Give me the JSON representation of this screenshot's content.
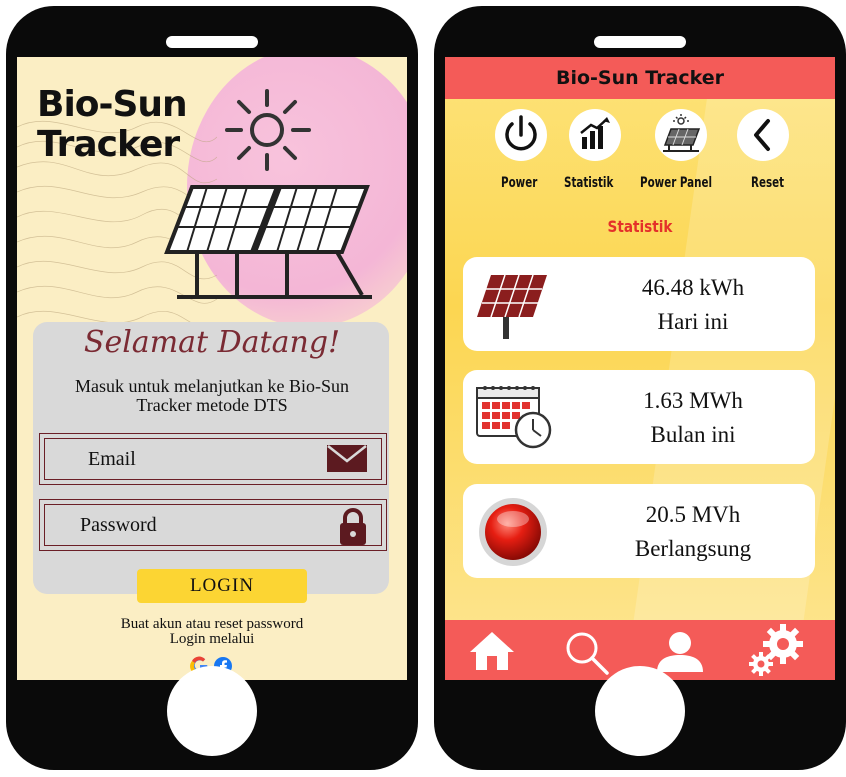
{
  "login_screen": {
    "brand_line1": "Bio-Sun",
    "brand_line2": "Tracker",
    "welcome": "Selamat Datang!",
    "subtitle_line1": "Masuk untuk melanjutkan ke Bio-Sun",
    "subtitle_line2": "Tracker metode DTS",
    "email_label": "Email",
    "password_label": "Password",
    "login_button": "LOGIN",
    "footer_line1": "Buat akun atau reset password",
    "footer_line2": "Login melalui",
    "social_icons": [
      "google-icon",
      "facebook-icon"
    ]
  },
  "dashboard_screen": {
    "header_title": "Bio-Sun Tracker",
    "nav": [
      {
        "label": "Power",
        "icon": "power-icon"
      },
      {
        "label": "Statistik",
        "icon": "bar-chart-icon"
      },
      {
        "label": "Power Panel",
        "icon": "solar-panel-icon"
      },
      {
        "label": "Reset",
        "icon": "chevron-left-icon"
      }
    ],
    "section_title": "Statistik",
    "stats": [
      {
        "value": "46.48 kWh",
        "label": "Hari ini",
        "icon": "solar-panel-icon"
      },
      {
        "value": "1.63 MWh",
        "label": "Bulan ini",
        "icon": "calendar-clock-icon"
      },
      {
        "value": "20.5 MVh",
        "label": "Berlangsung",
        "icon": "red-status-icon"
      }
    ],
    "bottom_nav": [
      "home-icon",
      "search-icon",
      "user-icon",
      "settings-icon"
    ]
  },
  "colors": {
    "accent_red": "#f45b58",
    "login_yellow": "#fcd533",
    "maroon": "#6b1f27",
    "stat_title_red": "#e4302a"
  }
}
